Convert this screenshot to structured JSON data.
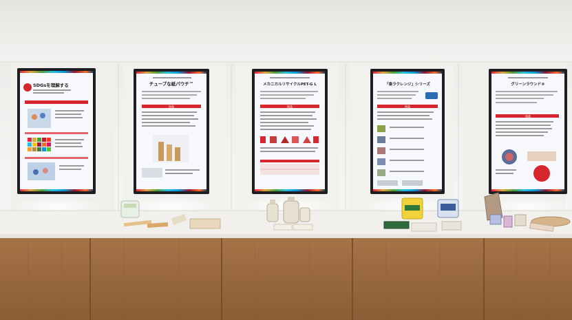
{
  "scene": {
    "description_type": "photo",
    "colors": {
      "wall": "#eeeeec",
      "ceiling": "#f4f4f2",
      "counter_top": "#f2f0ec",
      "wood": "#9a6a3f",
      "wood_dark": "#7d522e",
      "screen_bezel": "#1e1e22",
      "screen_bg": "#f7f8fb",
      "accent_red": "#d7262e"
    }
  },
  "screens": [
    {
      "title": "SDGsを理解する",
      "subtitle": "",
      "sections": [
        "SDGsを理解する",
        "",
        ""
      ]
    },
    {
      "title": "チューブな紙パウチ™",
      "subtitle": "",
      "sections": [
        "特長",
        ""
      ]
    },
    {
      "title": "メカニカルリサイクルPET-G L",
      "subtitle": "",
      "sections": [
        "特長",
        ""
      ]
    },
    {
      "title": "「楽ラクレンジ」シリーズ",
      "subtitle": "",
      "sections": [
        "特長",
        ""
      ]
    },
    {
      "title": "グリーンラウンド®",
      "subtitle": "",
      "sections": [
        "特長",
        ""
      ]
    }
  ]
}
